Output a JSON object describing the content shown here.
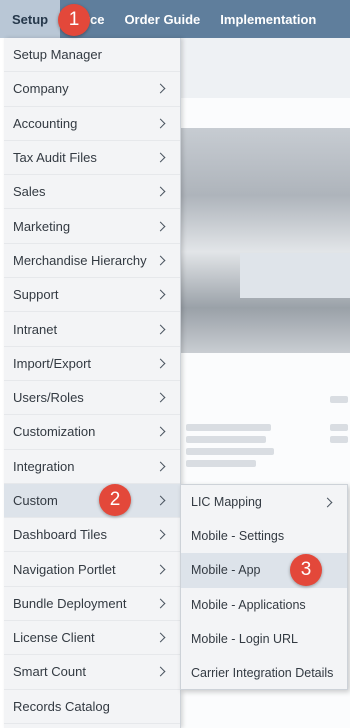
{
  "topnav": {
    "setup": "Setup",
    "commerce_partial": "merce",
    "order_guide": "Order Guide",
    "implementation": "Implementation"
  },
  "menu": [
    {
      "label": "Setup Manager",
      "has_submenu": false
    },
    {
      "label": "Company",
      "has_submenu": true
    },
    {
      "label": "Accounting",
      "has_submenu": true
    },
    {
      "label": "Tax Audit Files",
      "has_submenu": true
    },
    {
      "label": "Sales",
      "has_submenu": true
    },
    {
      "label": "Marketing",
      "has_submenu": true
    },
    {
      "label": "Merchandise Hierarchy",
      "has_submenu": true
    },
    {
      "label": "Support",
      "has_submenu": true
    },
    {
      "label": "Intranet",
      "has_submenu": true
    },
    {
      "label": "Import/Export",
      "has_submenu": true
    },
    {
      "label": "Users/Roles",
      "has_submenu": true
    },
    {
      "label": "Customization",
      "has_submenu": true
    },
    {
      "label": "Integration",
      "has_submenu": true
    },
    {
      "label": "Custom",
      "has_submenu": true,
      "highlighted": true
    },
    {
      "label": "Dashboard Tiles",
      "has_submenu": true
    },
    {
      "label": "Navigation Portlet",
      "has_submenu": true
    },
    {
      "label": "Bundle Deployment",
      "has_submenu": true
    },
    {
      "label": "License Client",
      "has_submenu": true
    },
    {
      "label": "Smart Count",
      "has_submenu": true
    },
    {
      "label": "Records Catalog",
      "has_submenu": false
    }
  ],
  "submenu": [
    {
      "label": "LIC Mapping",
      "has_submenu": true
    },
    {
      "label": "Mobile - Settings",
      "has_submenu": false
    },
    {
      "label": "Mobile - App",
      "has_submenu": false,
      "highlighted": true
    },
    {
      "label": "Mobile - Applications",
      "has_submenu": false
    },
    {
      "label": "Mobile - Login URL",
      "has_submenu": false
    },
    {
      "label": "Carrier Integration Details",
      "has_submenu": false
    }
  ],
  "badges": {
    "one": "1",
    "two": "2",
    "three": "3"
  },
  "colors": {
    "nav_bg": "#5f7e9c",
    "nav_active": "#b9c7d6",
    "menu_bg": "#f3f4f6",
    "highlight": "#dde3ea",
    "badge": "#e3483a"
  }
}
